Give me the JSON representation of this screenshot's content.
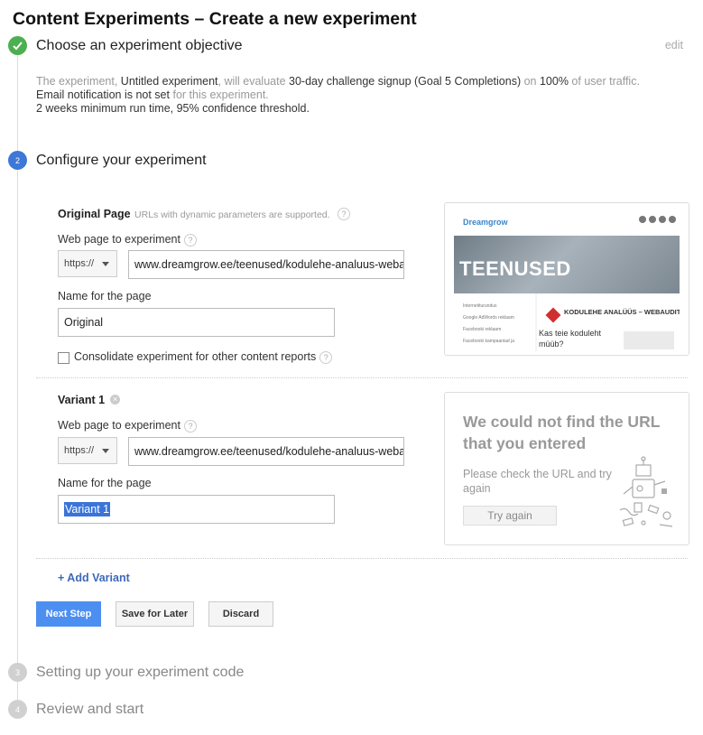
{
  "page_title": "Content Experiments – Create a new experiment",
  "steps": [
    {
      "number": "",
      "label": "Choose an experiment objective"
    },
    {
      "number": "2",
      "label": "Configure your experiment"
    },
    {
      "number": "3",
      "label": "Setting up your experiment code"
    },
    {
      "number": "4",
      "label": "Review and start"
    }
  ],
  "objective": {
    "edit_label": "edit",
    "t1": "The experiment, ",
    "experiment_name": "Untitled experiment",
    "t2": ", will evaluate ",
    "goal": "30-day challenge signup (Goal 5 Completions)",
    "t3": " on ",
    "traffic": "100%",
    "t4": " of user traffic.",
    "email_status": "Email notification is not set",
    "t5": " for this experiment.",
    "runtime": "2 weeks minimum run time, 95% confidence threshold."
  },
  "original": {
    "heading": "Original Page",
    "hint": "URLs with dynamic parameters are supported.",
    "url_label": "Web page to experiment",
    "protocol": "https://",
    "url": "www.dreamgrow.ee/teenused/kodulehe-analuus-webaudit",
    "name_label": "Name for the page",
    "name_value": "Original",
    "consolidate_label": "Consolidate experiment for other content reports",
    "preview": {
      "logo": "Dreamgrow",
      "hero_text": "TEENUSED",
      "article_title": "KODULEHE ANALÜÜS – WEBAUDIT",
      "article_sub": "Kas teie koduleht müüb?",
      "sidebar_items": [
        "Internetiturundus",
        "Google AdWords reklaam",
        "Facebooki reklaam",
        "Facebooki kampaaniad ja"
      ]
    }
  },
  "variant": {
    "heading": "Variant 1",
    "url_label": "Web page to experiment",
    "protocol": "https://",
    "url": "www.dreamgrow.ee/teenused/kodulehe-analuus-webaudit",
    "name_label": "Name for the page",
    "name_value": "Variant 1",
    "error_title": "We could not find the URL that you entered",
    "error_text": "Please check the URL and try again",
    "try_again": "Try again"
  },
  "add_variant": "+ Add Variant",
  "buttons": {
    "next": "Next Step",
    "save": "Save for Later",
    "discard": "Discard"
  },
  "colors": {
    "accent": "#4d8ff0",
    "done": "#4caf50",
    "link": "#3d68b8"
  }
}
